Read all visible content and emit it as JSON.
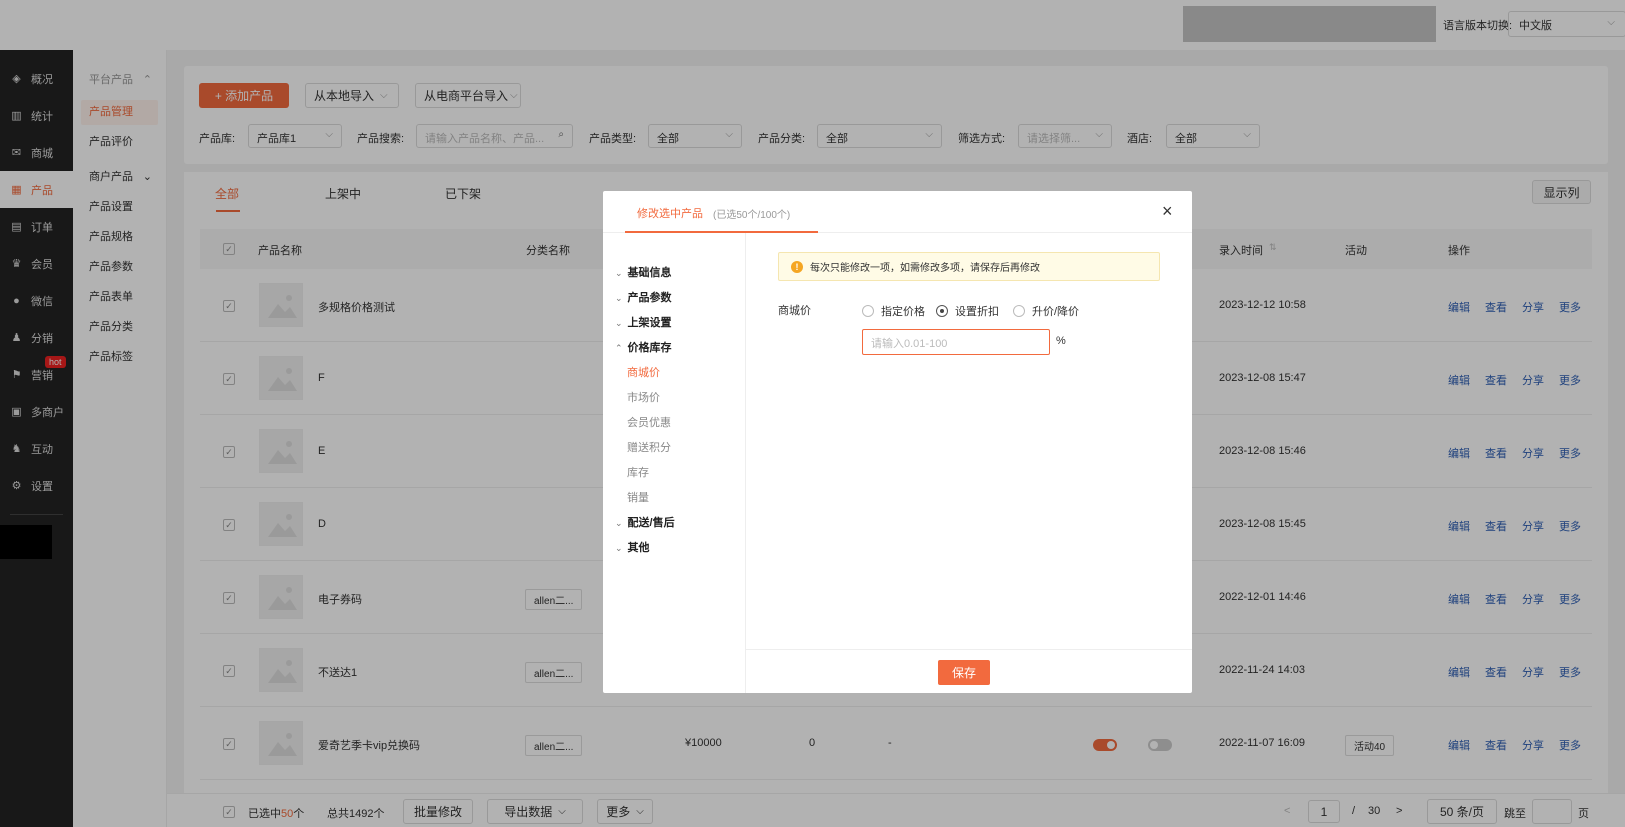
{
  "topbar": {
    "lang_label": "语言版本切换:",
    "lang_value": "中文版"
  },
  "sidebar": {
    "items": [
      {
        "label": "概况",
        "icon": "layers-icon"
      },
      {
        "label": "统计",
        "icon": "chart-icon"
      },
      {
        "label": "商城",
        "icon": "mail-icon"
      },
      {
        "label": "产品",
        "icon": "grid-icon"
      },
      {
        "label": "订单",
        "icon": "clipboard-icon"
      },
      {
        "label": "会员",
        "icon": "crown-icon"
      },
      {
        "label": "微信",
        "icon": "wechat-icon"
      },
      {
        "label": "分销",
        "icon": "user-share-icon"
      },
      {
        "label": "营销",
        "icon": "flag-icon"
      },
      {
        "label": "多商户",
        "icon": "store-icon"
      },
      {
        "label": "互动",
        "icon": "people-icon"
      },
      {
        "label": "设置",
        "icon": "gear-icon"
      }
    ],
    "hot_badge": "hot"
  },
  "subnav": {
    "platform_header": "平台产品",
    "items1": [
      "产品管理",
      "产品评价"
    ],
    "merchant_header": "商户产品",
    "items2": [
      "产品设置",
      "产品规格",
      "产品参数",
      "产品表单",
      "产品分类",
      "产品标签"
    ]
  },
  "filter": {
    "add_btn": "+ 添加产品",
    "import_local": "从本地导入",
    "import_ecom": "从电商平台导入",
    "lib_label": "产品库:",
    "lib_value": "产品库1",
    "search_label": "产品搜索:",
    "search_placeholder": "请输入产品名称、产品...",
    "type_label": "产品类型:",
    "type_value": "全部",
    "cat_label": "产品分类:",
    "cat_value": "全部",
    "filter_label": "筛选方式:",
    "filter_placeholder": "请选择筛...",
    "hotel_label": "酒店:",
    "hotel_value": "全部"
  },
  "tabs": [
    "全部",
    "上架中",
    "已下架"
  ],
  "show_cols": "显示列",
  "table": {
    "headers": {
      "name": "产品名称",
      "category": "分类名称",
      "time": "录入时间",
      "activity": "活动",
      "ops": "操作"
    },
    "rows": [
      {
        "name": "多规格价格测试",
        "category": "",
        "time": "2023-12-12 10:58"
      },
      {
        "name": "F",
        "category": "",
        "time": "2023-12-08 15:47"
      },
      {
        "name": "E",
        "category": "",
        "time": "2023-12-08 15:46"
      },
      {
        "name": "D",
        "category": "",
        "time": "2023-12-08 15:45"
      },
      {
        "name": "电子券码",
        "category": "allen二...",
        "time": "2022-12-01 14:46"
      },
      {
        "name": "不送达1",
        "category": "allen二...",
        "time": "2022-11-24 14:03"
      },
      {
        "name": "爱奇艺季卡vip兑换码",
        "category": "allen二...",
        "time": "2022-11-07 16:09",
        "price": "¥10000",
        "stock": "0",
        "dash": "-",
        "activity": "活动40"
      }
    ],
    "ops": [
      "编辑",
      "查看",
      "分享",
      "更多"
    ]
  },
  "bottom": {
    "selected_prefix": "已选中",
    "selected_count": "50",
    "selected_suffix": "个",
    "total": "总共1492个",
    "batch": "批量修改",
    "export": "导出数据",
    "more": "更多",
    "page_prev": "<",
    "page_current": "1",
    "page_sep": "/",
    "page_total": "30",
    "page_next": ">",
    "page_size": "50 条/页",
    "jump": "跳至",
    "page_unit": "页"
  },
  "modal": {
    "title": "修改选中产品",
    "subtitle": "(已选50个/100个)",
    "close": "×",
    "groups": [
      "基础信息",
      "产品参数",
      "上架设置",
      "价格库存"
    ],
    "price_items": [
      "商城价",
      "市场价",
      "会员优惠",
      "赠送积分",
      "库存",
      "销量"
    ],
    "groups2": [
      "配送/售后",
      "其他"
    ],
    "notice": "每次只能修改一项，如需修改多项，请保存后再修改",
    "field_label": "商城价",
    "radios": [
      "指定价格",
      "设置折扣",
      "升价/降价"
    ],
    "input_placeholder": "请输入0.01-100",
    "percent": "%",
    "save": "保存"
  },
  "colors": {
    "accent": "#f26a3e",
    "sidebar": "#232323",
    "link": "#2d5eb4"
  }
}
